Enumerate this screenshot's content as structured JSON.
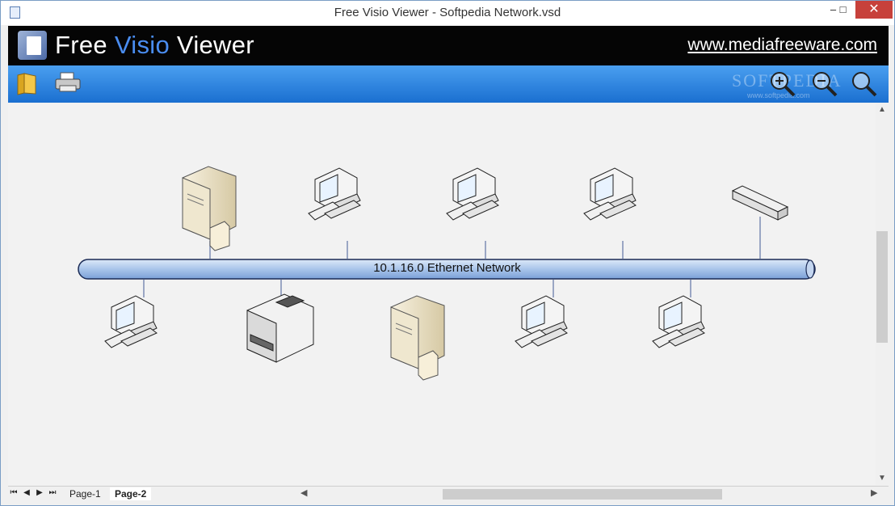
{
  "window": {
    "title": "Free Visio Viewer  -  Softpedia Network.vsd",
    "minimize_label": "–",
    "maximize_label": "□",
    "close_label": "✕"
  },
  "banner": {
    "app_name_part1": "Free ",
    "app_name_part2": "Visio",
    "app_name_part3": " Viewer",
    "website": "www.mediafreeware.com",
    "accent_color": "#4a8df0"
  },
  "toolbar": {
    "open_icon": "folder-icon",
    "print_icon": "printer-icon",
    "zoom_in_icon": "zoom-in-icon",
    "zoom_out_icon": "zoom-out-icon",
    "zoom_fit_icon": "zoom-icon",
    "watermark": "SOFTPEDIA",
    "watermark_sub": "www.softpedia.com"
  },
  "diagram": {
    "network_label": "10.1.16.0 Ethernet Network",
    "top_devices": [
      "server",
      "workstation",
      "workstation",
      "workstation",
      "hub"
    ],
    "bottom_devices": [
      "workstation",
      "printer",
      "server",
      "workstation",
      "workstation"
    ]
  },
  "pager": {
    "first": "⏮",
    "prev": "◀",
    "next": "▶",
    "last": "⏭",
    "tabs": [
      {
        "label": "Page-1"
      },
      {
        "label": "Page-2"
      }
    ]
  }
}
